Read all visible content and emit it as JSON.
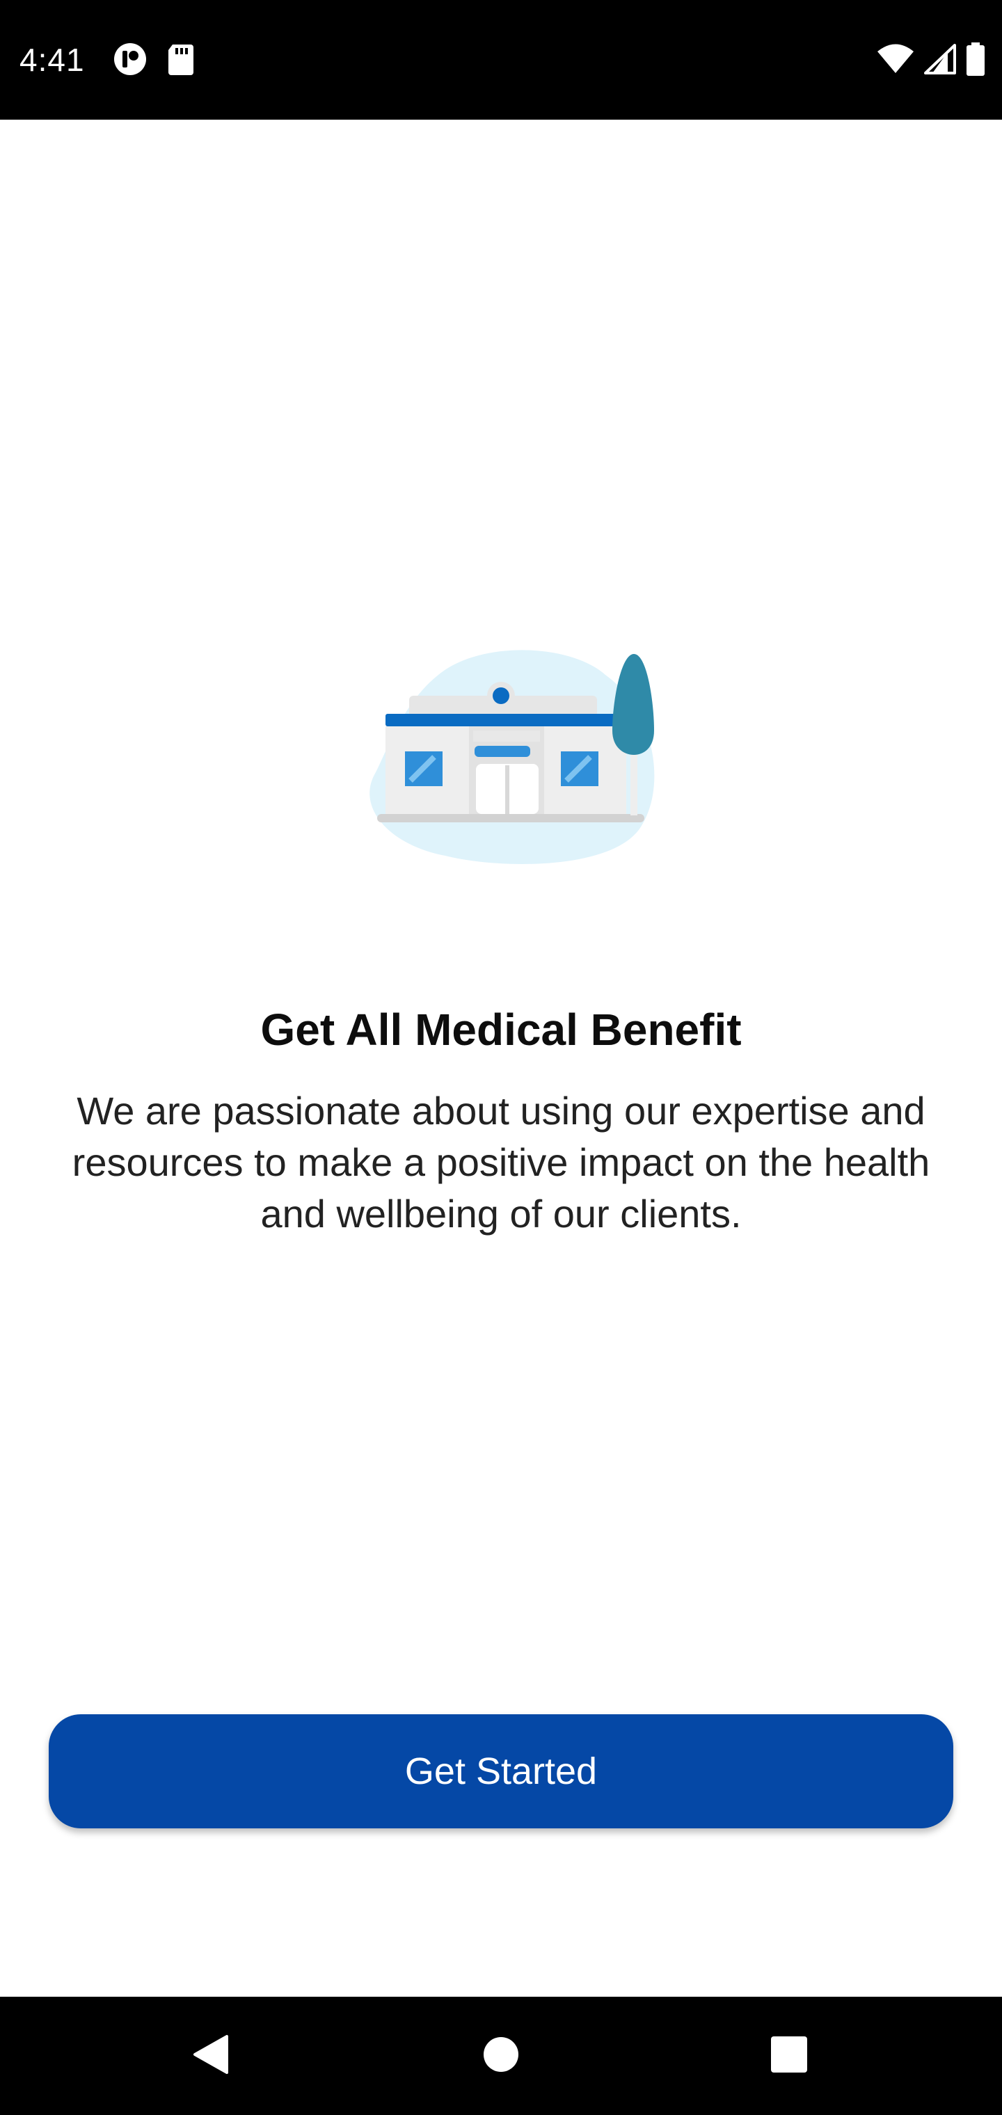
{
  "status_bar": {
    "time": "4:41",
    "left_icons": [
      "app-notification-icon",
      "sd-card-icon"
    ],
    "right_icons": [
      "wifi-icon",
      "cellular-signal-icon",
      "battery-icon"
    ]
  },
  "onboarding": {
    "illustration": "hospital-building-illustration",
    "title": "Get All Medical Benefit",
    "description": "We are passionate about using our expertise and resources to make a positive impact on the health and wellbeing of our clients.",
    "cta_label": "Get Started"
  },
  "nav_bar": {
    "buttons": [
      "back-icon",
      "home-icon",
      "recents-icon"
    ]
  },
  "colors": {
    "primary": "#0548a6",
    "illustration_blob": "#dff3fb",
    "tree": "#2f8aa8",
    "building_blue": "#0a6bc2",
    "window_blue": "#2f8fd9",
    "status_bar": "#000000"
  }
}
